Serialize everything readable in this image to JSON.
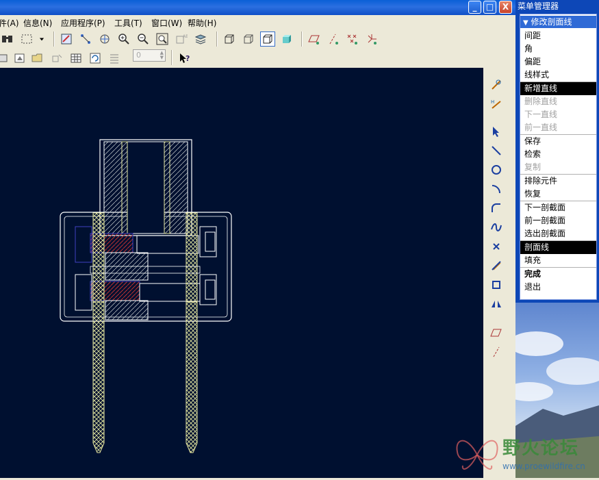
{
  "window": {
    "buttons": {
      "minimize": "_",
      "maximize": "□",
      "close": "X"
    }
  },
  "menubar": {
    "items": [
      "文件(A)",
      "信息(N)",
      "应用程序(P)",
      "工具(T)",
      "窗口(W)",
      "帮助(H)"
    ]
  },
  "toolbar": {
    "spinner_value": "0"
  },
  "menu_manager": {
    "title": "菜单管理器",
    "header": "修改剖面线",
    "groups": [
      [
        {
          "label": "间距",
          "state": "normal"
        },
        {
          "label": "角",
          "state": "normal"
        },
        {
          "label": "偏距",
          "state": "normal"
        },
        {
          "label": "线样式",
          "state": "normal"
        }
      ],
      [
        {
          "label": "新增直线",
          "state": "selected"
        },
        {
          "label": "删除直线",
          "state": "disabled"
        },
        {
          "label": "下一直线",
          "state": "disabled"
        },
        {
          "label": "前一直线",
          "state": "disabled"
        }
      ],
      [
        {
          "label": "保存",
          "state": "normal"
        },
        {
          "label": "检索",
          "state": "normal"
        },
        {
          "label": "复制",
          "state": "disabled"
        }
      ],
      [
        {
          "label": "排除元件",
          "state": "normal"
        },
        {
          "label": "恢复",
          "state": "normal"
        }
      ],
      [
        {
          "label": "下一剖截面",
          "state": "normal"
        },
        {
          "label": "前一剖截面",
          "state": "normal"
        },
        {
          "label": "选出剖截面",
          "state": "normal"
        }
      ],
      [
        {
          "label": "剖面线",
          "state": "selected"
        },
        {
          "label": "填充",
          "state": "normal"
        }
      ],
      [
        {
          "label": "完成",
          "state": "bold"
        },
        {
          "label": "退出",
          "state": "normal"
        }
      ]
    ]
  },
  "watermark": {
    "title": "野火论坛",
    "url": "www.proewildfire.cn"
  },
  "colors": {
    "canvas": "#001030",
    "outline": "#ffffff",
    "hatch": "#e8e8a0",
    "highlight": "#c03030"
  }
}
